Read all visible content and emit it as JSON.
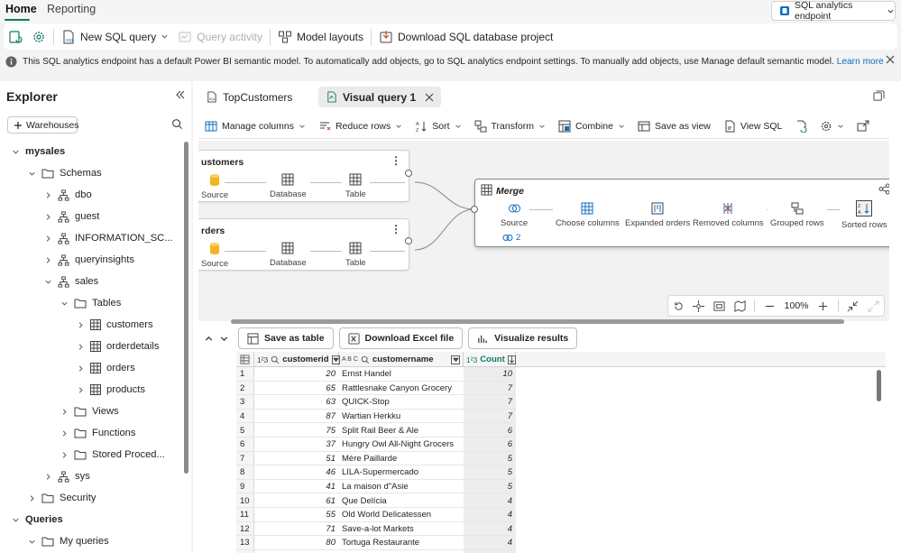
{
  "nav": {
    "tabs": [
      {
        "label": "Home"
      },
      {
        "label": "Reporting"
      }
    ],
    "endpoint_label": "SQL analytics endpoint"
  },
  "ribbon": {
    "new_sql_query": "New SQL query",
    "query_activity": "Query activity",
    "model_layouts": "Model layouts",
    "download_project": "Download SQL database project"
  },
  "infobar": {
    "message": "This SQL analytics endpoint has a default Power BI semantic model. To automatically add objects, go to SQL analytics endpoint settings. To manually add objects, use Manage default semantic model.",
    "link": "Learn more"
  },
  "explorer": {
    "title": "Explorer",
    "warehouses_button": "Warehouses",
    "tree": [
      {
        "label": "mysales"
      },
      {
        "label": "Schemas"
      },
      {
        "label": "dbo"
      },
      {
        "label": "guest"
      },
      {
        "label": "INFORMATION_SC..."
      },
      {
        "label": "queryinsights"
      },
      {
        "label": "sales"
      },
      {
        "label": "Tables"
      },
      {
        "label": "customers"
      },
      {
        "label": "orderdetails"
      },
      {
        "label": "orders"
      },
      {
        "label": "products"
      },
      {
        "label": "Views"
      },
      {
        "label": "Functions"
      },
      {
        "label": "Stored Proced..."
      },
      {
        "label": "sys"
      },
      {
        "label": "Security"
      },
      {
        "label": "Queries"
      },
      {
        "label": "My queries"
      }
    ]
  },
  "query_tabs": [
    {
      "label": "TopCustomers"
    },
    {
      "label": "Visual query 1"
    }
  ],
  "toolbar": {
    "manage_columns": "Manage columns",
    "reduce_rows": "Reduce rows",
    "sort": "Sort",
    "transform": "Transform",
    "combine": "Combine",
    "save_as_view": "Save as view",
    "view_sql": "View SQL"
  },
  "diagram": {
    "customers_node": {
      "title": "ustomers",
      "steps": [
        "Source",
        "Database",
        "Table"
      ]
    },
    "orders_node": {
      "title": "rders",
      "steps": [
        "Source",
        "Database",
        "Table"
      ]
    },
    "merge_node": {
      "title": "Merge",
      "steps": [
        "Source",
        "Choose columns",
        "Expanded orders",
        "Removed columns",
        "Grouped rows",
        "Sorted rows"
      ],
      "source_link_count": "2"
    },
    "zoom_level": "100%"
  },
  "results": {
    "save_as_table": "Save as table",
    "download_excel": "Download Excel file",
    "visualize": "Visualize results",
    "columns": [
      {
        "name": "customerid",
        "type": "1²3"
      },
      {
        "name": "customername",
        "type": "A B C"
      },
      {
        "name": "Count",
        "type": "1²3"
      }
    ],
    "rows": [
      {
        "n": "1",
        "id": "20",
        "name": "Ernst Handel",
        "count": "10"
      },
      {
        "n": "2",
        "id": "65",
        "name": "Rattlesnake Canyon Grocery",
        "count": "7"
      },
      {
        "n": "3",
        "id": "63",
        "name": "QUICK-Stop",
        "count": "7"
      },
      {
        "n": "4",
        "id": "87",
        "name": "Wartian Herkku",
        "count": "7"
      },
      {
        "n": "5",
        "id": "75",
        "name": "Split Rail Beer & Ale",
        "count": "6"
      },
      {
        "n": "6",
        "id": "37",
        "name": "Hungry Owl All-Night Grocers",
        "count": "6"
      },
      {
        "n": "7",
        "id": "51",
        "name": "Mère Paillarde",
        "count": "5"
      },
      {
        "n": "8",
        "id": "46",
        "name": "LILA-Supermercado",
        "count": "5"
      },
      {
        "n": "9",
        "id": "41",
        "name": "La maison d\"Asie",
        "count": "5"
      },
      {
        "n": "10",
        "id": "61",
        "name": "Que Delícia",
        "count": "4"
      },
      {
        "n": "11",
        "id": "55",
        "name": "Old World Delicatessen",
        "count": "4"
      },
      {
        "n": "12",
        "id": "71",
        "name": "Save-a-lot Markets",
        "count": "4"
      },
      {
        "n": "13",
        "id": "80",
        "name": "Tortuga Restaurante",
        "count": "4"
      }
    ]
  },
  "colors": {
    "accent": "#117865",
    "link": "#0f6cbd",
    "excel_green": "#107c41",
    "source_yellow": "#f2b51d",
    "grid_blue": "#0f6cbd"
  }
}
